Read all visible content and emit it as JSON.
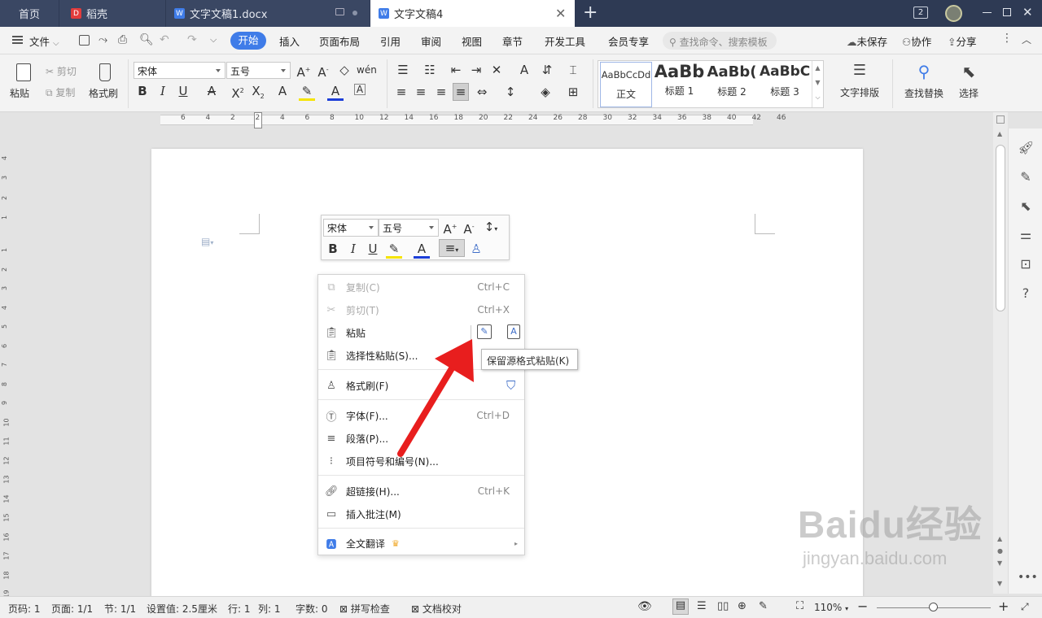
{
  "tabs": {
    "home": "首页",
    "daoke": "稻壳",
    "doc1": "文字文稿1.docx",
    "doc4": "文字文稿4",
    "badge": "2"
  },
  "menu": {
    "file": "文件",
    "items": [
      "开始",
      "插入",
      "页面布局",
      "引用",
      "审阅",
      "视图",
      "章节",
      "开发工具",
      "会员专享"
    ],
    "search_placeholder": "查找命令、搜索模板",
    "unsaved": "未保存",
    "collab": "协作",
    "share": "分享"
  },
  "ribbon": {
    "paste": "粘贴",
    "cut": "剪切",
    "copy": "复制",
    "format_painter": "格式刷",
    "font_name": "宋体",
    "font_size": "五号",
    "styles": [
      {
        "sample": "AaBbCcDd",
        "label": "正文"
      },
      {
        "sample": "AaBb",
        "label": "标题 1"
      },
      {
        "sample": "AaBb(",
        "label": "标题 2"
      },
      {
        "sample": "AaBbC(",
        "label": "标题 3"
      }
    ],
    "text_layout": "文字排版",
    "find_replace": "查找替换",
    "select": "选择"
  },
  "mini_toolbar": {
    "font_name": "宋体",
    "font_size": "五号"
  },
  "context_menu": {
    "copy": {
      "label": "复制(C)",
      "shortcut": "Ctrl+C"
    },
    "cut": {
      "label": "剪切(T)",
      "shortcut": "Ctrl+X"
    },
    "paste": {
      "label": "粘贴"
    },
    "paste_special": {
      "label": "选择性粘贴(S)..."
    },
    "format_painter": {
      "label": "格式刷(F)"
    },
    "font": {
      "label": "字体(F)...",
      "shortcut": "Ctrl+D"
    },
    "paragraph": {
      "label": "段落(P)..."
    },
    "bullets": {
      "label": "项目符号和编号(N)..."
    },
    "hyperlink": {
      "label": "超链接(H)...",
      "shortcut": "Ctrl+K"
    },
    "comment": {
      "label": "插入批注(M)"
    },
    "translate": {
      "label": "全文翻译"
    }
  },
  "tooltip": "保留源格式粘贴(K)",
  "status": {
    "page": "页码: 1",
    "pages": "页面: 1/1",
    "section": "节: 1/1",
    "setting": "设置值: 2.5厘米",
    "row": "行: 1",
    "col": "列: 1",
    "words": "字数: 0",
    "spellcheck": "拼写检查",
    "proofread": "文档校对",
    "zoom": "110%"
  },
  "ruler_numbers": [
    "6",
    "4",
    "2",
    "2",
    "4",
    "6",
    "8",
    "10",
    "12",
    "14",
    "16",
    "18",
    "20",
    "22",
    "24",
    "26",
    "28",
    "30",
    "32",
    "34",
    "36",
    "38",
    "40",
    "42",
    "46"
  ],
  "vruler_numbers": [
    "4",
    "3",
    "2",
    "1",
    "1",
    "2",
    "3",
    "4",
    "5",
    "6",
    "7",
    "8",
    "9",
    "10",
    "11",
    "12",
    "13",
    "14",
    "15",
    "16",
    "17",
    "18",
    "19"
  ],
  "watermark": {
    "brand": "Baidu经验",
    "url": "jingyan.baidu.com"
  },
  "colors": {
    "accent": "#3f7ce8",
    "arrow": "#e81e1e",
    "titlebar": "#2e3a54"
  }
}
